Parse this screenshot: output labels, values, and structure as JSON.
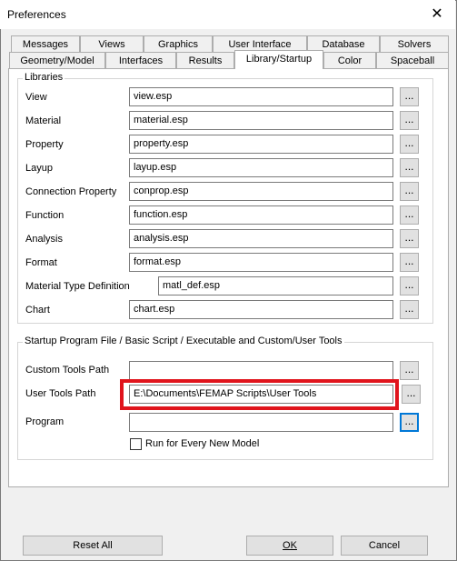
{
  "window": {
    "title": "Preferences",
    "close_glyph": "✕"
  },
  "tabs_row1": [
    "Messages",
    "Views",
    "Graphics",
    "User Interface",
    "Database",
    "Solvers"
  ],
  "tabs_row2": [
    "Geometry/Model",
    "Interfaces",
    "Results",
    "Library/Startup",
    "Color",
    "Spaceball"
  ],
  "active_tab": "Library/Startup",
  "libraries": {
    "title": "Libraries",
    "rows": [
      {
        "label": "View",
        "value": "view.esp"
      },
      {
        "label": "Material",
        "value": "material.esp"
      },
      {
        "label": "Property",
        "value": "property.esp"
      },
      {
        "label": "Layup",
        "value": "layup.esp"
      },
      {
        "label": "Connection Property",
        "value": "conprop.esp"
      },
      {
        "label": "Function",
        "value": "function.esp"
      },
      {
        "label": "Analysis",
        "value": "analysis.esp"
      },
      {
        "label": "Format",
        "value": "format.esp"
      },
      {
        "label": "Material Type Definition",
        "value": "matl_def.esp"
      },
      {
        "label": "Chart",
        "value": "chart.esp"
      }
    ],
    "browse_label": "..."
  },
  "startup": {
    "title": "Startup Program File / Basic Script / Executable and Custom/User Tools",
    "rows": [
      {
        "label": "Custom Tools Path",
        "value": ""
      },
      {
        "label": "User Tools Path",
        "value": "E:\\Documents\\FEMAP Scripts\\User Tools"
      },
      {
        "label": "Program",
        "value": ""
      }
    ],
    "browse_label": "...",
    "checkbox_label": "Run for Every New Model",
    "checkbox_checked": false
  },
  "buttons": {
    "reset": "Reset All",
    "ok": "OK",
    "cancel": "Cancel"
  },
  "colors": {
    "highlight": "#e0141c",
    "focus": "#0078d7"
  }
}
